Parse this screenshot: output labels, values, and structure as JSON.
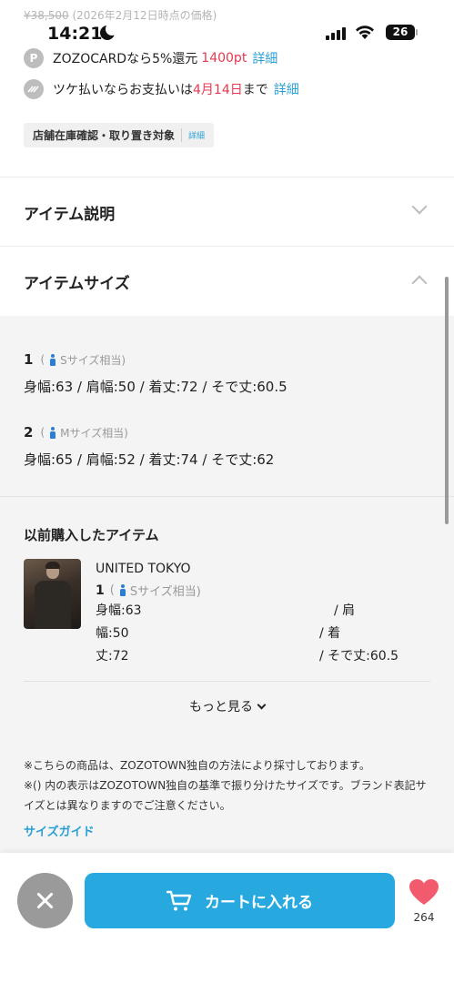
{
  "price": {
    "original": "¥38,500",
    "note": "(2026年2月12日時点の価格)"
  },
  "status_bar": {
    "time": "14:21",
    "battery": "26"
  },
  "zozocard": {
    "icon_letter": "P",
    "text": "ZOZOCARDなら5%還元",
    "points": "1400pt",
    "link": "詳細"
  },
  "tsuke": {
    "text_before": "ツケ払いならお支払いは",
    "date": "4月14日",
    "text_after": "まで",
    "link": "詳細"
  },
  "store_tag": {
    "label": "店舗在庫確認・取り置き対象",
    "link": "詳細"
  },
  "accordions": {
    "description": {
      "label": "アイテム説明",
      "expanded": false
    },
    "size": {
      "label": "アイテムサイズ",
      "expanded": true
    }
  },
  "sizes": [
    {
      "name": "1",
      "note_open": "(",
      "note": "Sサイズ相当)",
      "dims": "身幅:63 / 肩幅:50 / 着丈:72 / そで丈:60.5"
    },
    {
      "name": "2",
      "note_open": "(",
      "note": "Mサイズ相当)",
      "dims": "身幅:65 / 肩幅:52 / 着丈:74 / そで丈:62"
    }
  ],
  "previous": {
    "title": "以前購入したアイテム",
    "brand": "UNITED TOKYO",
    "size_name": "1",
    "size_note_open": "(",
    "size_note": "Sサイズ相当)",
    "lines": [
      {
        "left": "身幅:63",
        "right": "/ 肩"
      },
      {
        "left": "幅:50",
        "right": "/ 着"
      },
      {
        "left": "丈:72",
        "right": "/ そで丈:60.5"
      }
    ],
    "more": "もっと見る"
  },
  "notes": [
    "※こちらの商品は、ZOZOTOWN独自の方法により採寸しております。",
    "※() 内の表示はZOZOTOWN独自の基準で振り分けたサイズです。ブランド表記サイズとは異なりますのでご注意ください。"
  ],
  "size_guide": "サイズガイド",
  "bottom": {
    "cart_label": "カートに入れる",
    "fav_count": "264"
  },
  "colors": {
    "accent_blue": "#27a9df",
    "link_blue": "#2a9fd6",
    "red": "#e8384f",
    "heart": "#f25b6e"
  }
}
